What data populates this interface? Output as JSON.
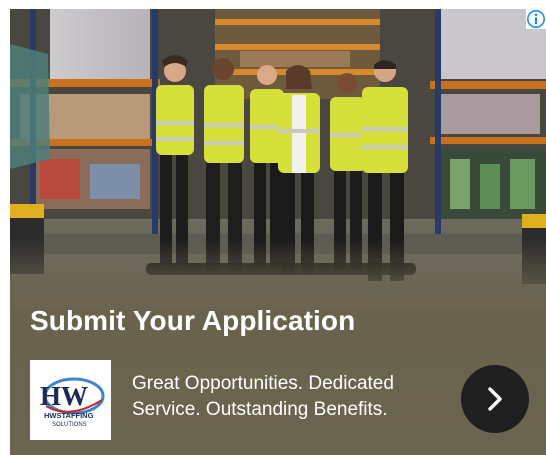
{
  "ad": {
    "headline": "Submit Your Application",
    "tagline": "Great Opportunities. Dedicated Service. Outstanding Benefits.",
    "logo": {
      "monogram": "HW",
      "wordmark_line1": "HWSTAFFING",
      "wordmark_line2": "SOLUTIONS",
      "brand_colors": {
        "navy": "#1b2a5a",
        "blue": "#3e86c9",
        "red": "#c8262c"
      }
    },
    "next_button_icon": "chevron-right-icon",
    "info_icon": "info-icon",
    "colors": {
      "card_background": "#6a6550",
      "button_background": "#1f1f1f",
      "info_icon": "#1e8fe0",
      "vest": "#d6e03a"
    }
  }
}
